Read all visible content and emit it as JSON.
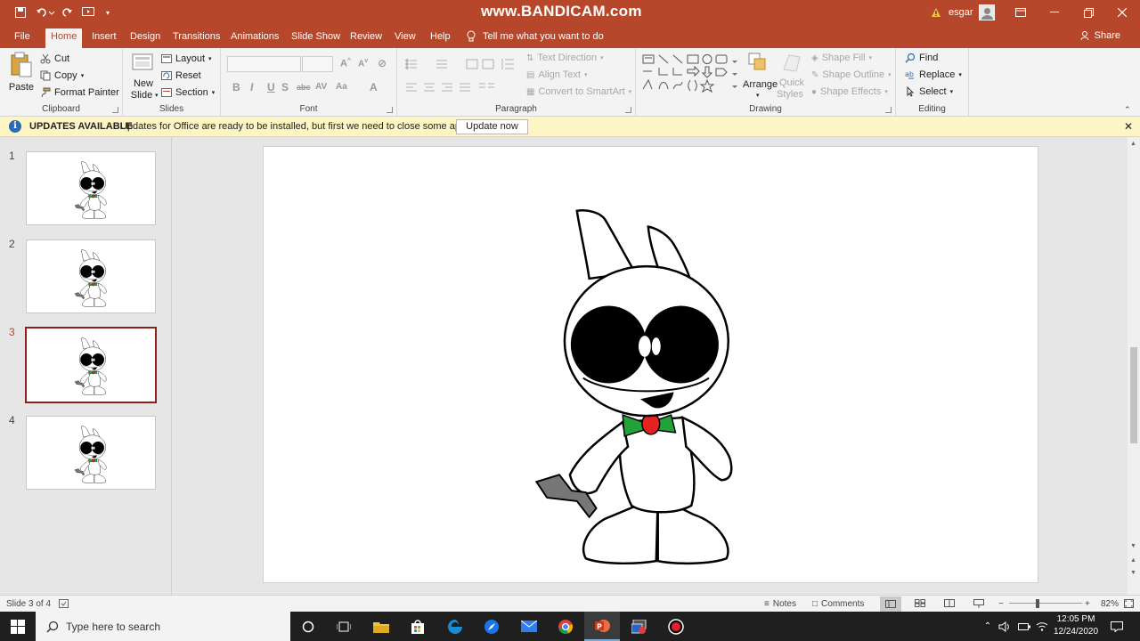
{
  "titlebar": {
    "watermark": "www.BANDICAM.com",
    "user": "esgar"
  },
  "tabs": [
    "File",
    "Home",
    "Insert",
    "Design",
    "Transitions",
    "Animations",
    "Slide Show",
    "Review",
    "View",
    "Help"
  ],
  "tellme": "Tell me what you want to do",
  "share": "Share",
  "ribbon": {
    "clipboard": {
      "paste": "Paste",
      "cut": "Cut",
      "copy": "Copy",
      "format_painter": "Format Painter",
      "label": "Clipboard"
    },
    "slides": {
      "new_slide_1": "New",
      "new_slide_2": "Slide",
      "layout": "Layout",
      "reset": "Reset",
      "section": "Section",
      "label": "Slides"
    },
    "font": {
      "label": "Font"
    },
    "paragraph": {
      "text_direction": "Text Direction",
      "align_text": "Align Text",
      "convert_smartart": "Convert to SmartArt",
      "label": "Paragraph"
    },
    "drawing": {
      "arrange": "Arrange",
      "quick_styles_1": "Quick",
      "quick_styles_2": "Styles",
      "shape_fill": "Shape Fill",
      "shape_outline": "Shape Outline",
      "shape_effects": "Shape Effects",
      "label": "Drawing"
    },
    "editing": {
      "find": "Find",
      "replace": "Replace",
      "select": "Select",
      "label": "Editing"
    }
  },
  "banner": {
    "title": "UPDATES AVAILABLE",
    "message": "Updates for Office are ready to be installed, but first we need to close some apps.",
    "button": "Update now"
  },
  "thumbnails": [
    "1",
    "2",
    "3",
    "4"
  ],
  "status": {
    "slide_info": "Slide 3 of 4",
    "notes": "Notes",
    "comments": "Comments",
    "zoom": "82%"
  },
  "taskbar": {
    "search_placeholder": "Type here to search",
    "time": "12:05 PM",
    "date": "12/24/2020"
  },
  "colors": {
    "accent": "#b7472a",
    "banner": "#fdf5c3",
    "selected_thumb_border": "#8e1f1f"
  }
}
